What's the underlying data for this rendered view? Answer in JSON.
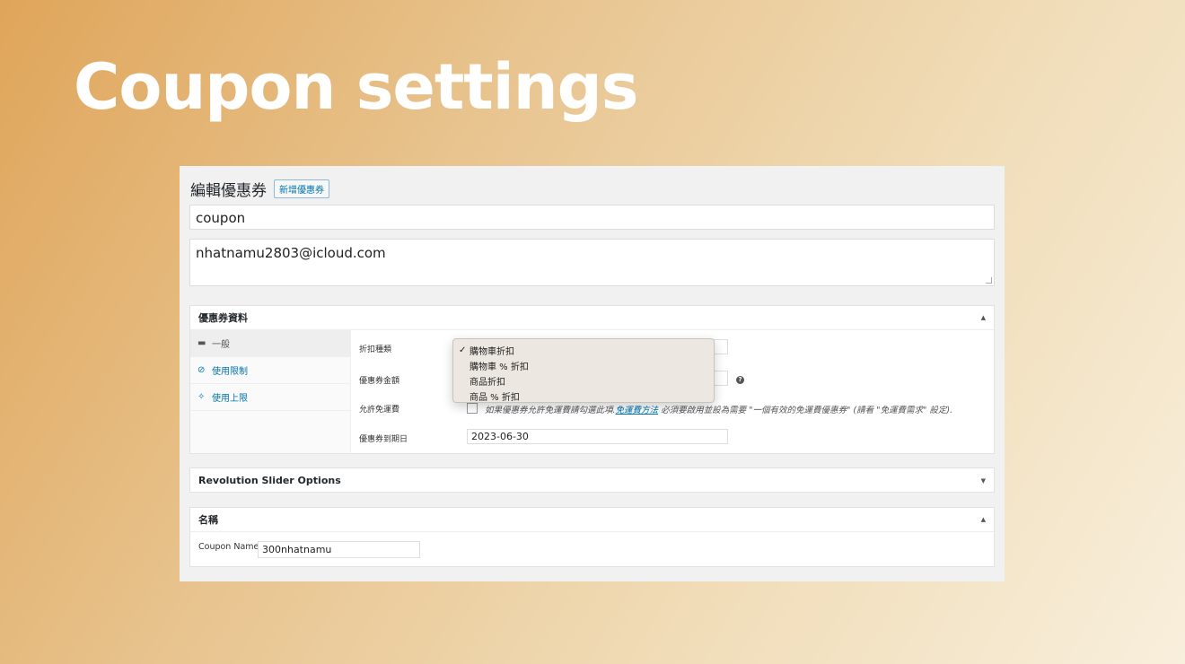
{
  "slide": {
    "title": "Coupon settings"
  },
  "page": {
    "heading": "編輯優惠券",
    "add_button": "新增優惠券"
  },
  "coupon": {
    "code": "coupon",
    "description": "nhatnamu2803@icloud.com"
  },
  "coupon_data": {
    "box_title": "優惠券資料",
    "tabs": [
      {
        "label": "一般",
        "icon": "ticket-icon",
        "active": true
      },
      {
        "label": "使用限制",
        "icon": "ban-icon"
      },
      {
        "label": "使用上限",
        "icon": "sparkle-icon"
      }
    ],
    "fields": {
      "discount_type_label": "折扣種類",
      "amount_label": "優惠券金額",
      "free_shipping_label": "允許免運費",
      "free_shipping_note_prefix": "如果優惠券允許免運費請勾選此項.",
      "free_shipping_link": "免運費方法",
      "free_shipping_note_suffix": "必須要啟用並設為需要 \"一個有效的免運費優惠券\" (請看 \"免運費需求\" 設定).",
      "expiry_label": "優惠券到期日",
      "expiry_value": "2023-06-30"
    },
    "dropdown": {
      "options": [
        "購物車折扣",
        "購物車 % 折扣",
        "商品折扣",
        "商品 % 折扣"
      ],
      "selected": "購物車折扣",
      "check": "✓"
    }
  },
  "revslider": {
    "title": "Revolution Slider Options"
  },
  "name_box": {
    "title": "名稱",
    "label": "Coupon Name",
    "value": "300nhatnamu"
  }
}
